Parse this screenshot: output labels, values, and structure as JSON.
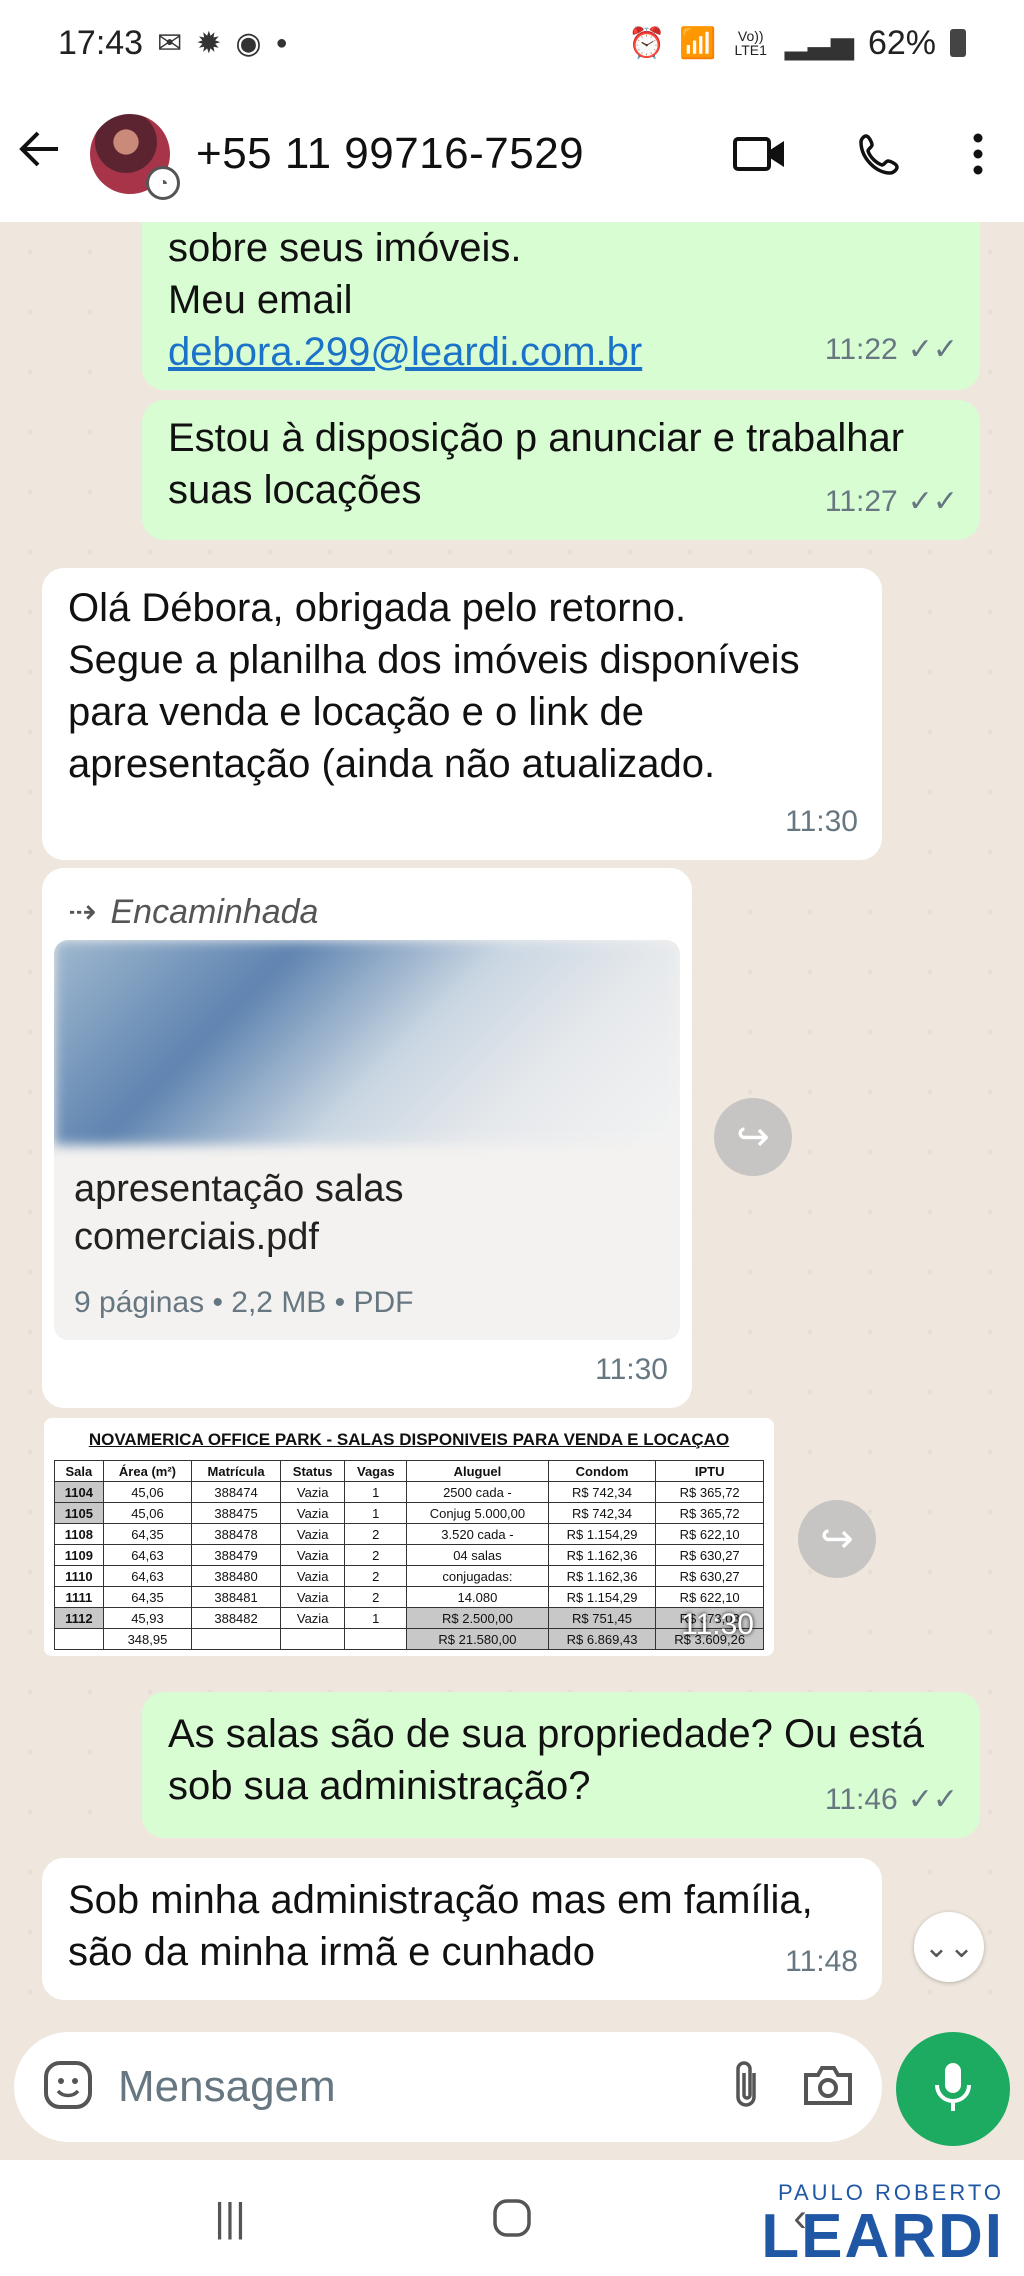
{
  "status_bar": {
    "time": "17:43",
    "signal_label": "Vo)) LTE1",
    "battery": "62%"
  },
  "header": {
    "contact": "+55 11 99716-7529"
  },
  "messages": [
    {
      "lines": [
        "sobre seus imóveis.",
        "Meu email"
      ],
      "link": "debora.299@leardi.com.br",
      "time": "11:22"
    },
    {
      "lines": [
        "Estou à disposição p anunciar e trabalhar",
        "suas locações"
      ],
      "time": "11:27"
    },
    {
      "lines": [
        "Olá Débora, obrigada pelo retorno.",
        "Segue a planilha dos imóveis disponíveis",
        "para venda e locação e o link de",
        "apresentação (ainda não atualizado."
      ],
      "time": "11:30"
    },
    {
      "forwarded_label": "Encaminhada",
      "doc_name_lines": [
        "apresentação salas",
        "comerciais.pdf"
      ],
      "doc_meta": "9 páginas • 2,2 MB • PDF",
      "time": "11:30"
    },
    {
      "time": "11:30"
    },
    {
      "lines": [
        "As salas são de sua propriedade? Ou está",
        "sob sua administração?"
      ],
      "time": "11:46"
    },
    {
      "lines": [
        "Sob minha administração mas em família,",
        "são da minha irmã e cunhado"
      ],
      "time": "11:48"
    }
  ],
  "spreadsheet": {
    "title": "NOVAMERICA OFFICE PARK - SALAS DISPONIVEIS PARA VENDA E LOCAÇAO",
    "headers": [
      "Sala",
      "Área (m²)",
      "Matrícula",
      "Status",
      "Vagas",
      "Aluguel",
      "Condom",
      "IPTU"
    ],
    "rows": [
      [
        "1104",
        "45,06",
        "388474",
        "Vazia",
        "1",
        "2500 cada -",
        "R$ 742,34",
        "R$ 365,72"
      ],
      [
        "1105",
        "45,06",
        "388475",
        "Vazia",
        "1",
        "Conjug 5.000,00",
        "R$ 742,34",
        "R$ 365,72"
      ],
      [
        "1108",
        "64,35",
        "388478",
        "Vazia",
        "2",
        "3.520 cada -",
        "R$ 1.154,29",
        "R$ 622,10"
      ],
      [
        "1109",
        "64,63",
        "388479",
        "Vazia",
        "2",
        "04 salas",
        "R$ 1.162,36",
        "R$ 630,27"
      ],
      [
        "1110",
        "64,63",
        "388480",
        "Vazia",
        "2",
        "conjugadas:",
        "R$ 1.162,36",
        "R$ 630,27"
      ],
      [
        "1111",
        "64,35",
        "388481",
        "Vazia",
        "2",
        "14.080",
        "R$ 1.154,29",
        "R$ 622,10"
      ],
      [
        "1112",
        "45,93",
        "388482",
        "Vazia",
        "1",
        "R$ 2.500,00",
        "R$ 751,45",
        "R$ 373,08"
      ],
      [
        "",
        "348,95",
        "",
        "",
        "",
        "R$ 21.580,00",
        "R$ 6.869,43",
        "R$ 3.609,26"
      ]
    ]
  },
  "composer": {
    "placeholder": "Mensagem"
  },
  "watermark": {
    "top": "PAULO ROBERTO",
    "bottom": "LEARDI"
  }
}
